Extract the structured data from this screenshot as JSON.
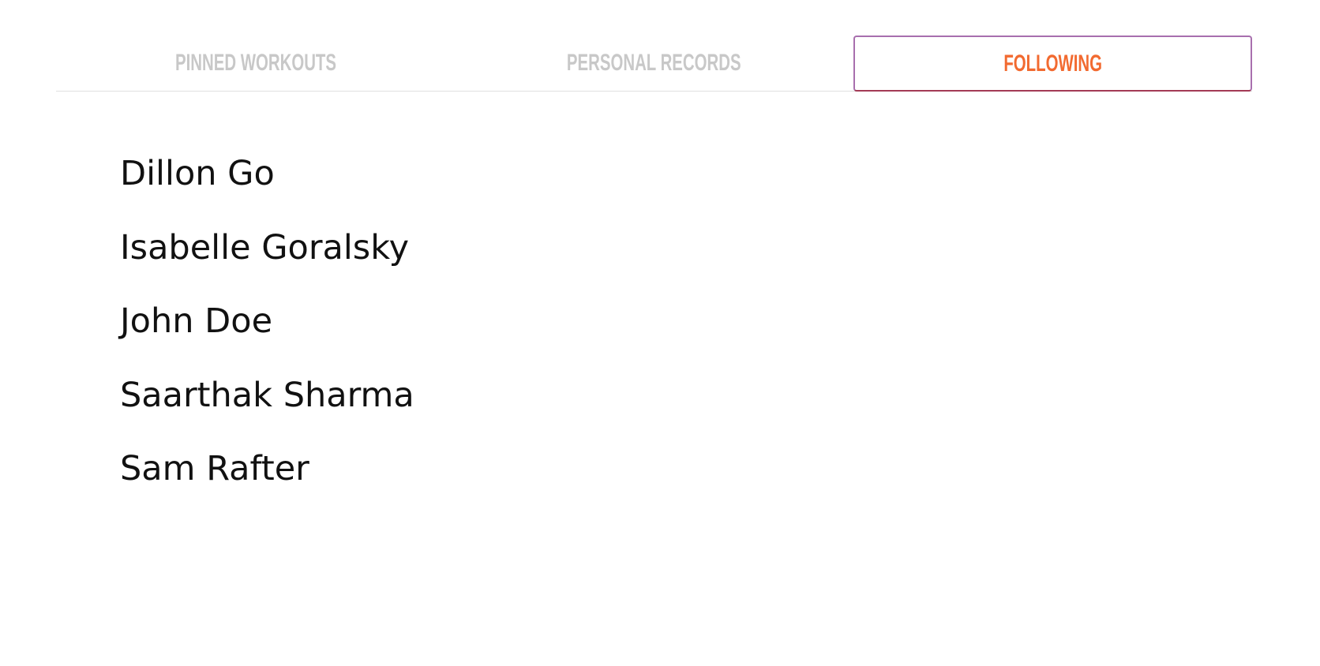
{
  "tabs": [
    {
      "label": "PINNED WORKOUTS",
      "active": false
    },
    {
      "label": "PERSONAL RECORDS",
      "active": false
    },
    {
      "label": "FOLLOWING",
      "active": true
    }
  ],
  "following": [
    "Dillon Go",
    "Isabelle Goralsky",
    "John Doe",
    "Saarthak Sharma",
    "Sam Rafter"
  ],
  "colors": {
    "active_text": "#f26a30",
    "active_border": "#a86fae",
    "inactive_text": "#c8c8c8"
  }
}
